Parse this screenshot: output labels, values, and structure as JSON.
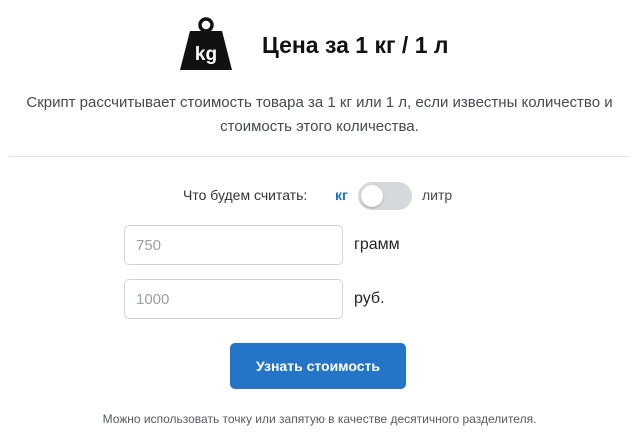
{
  "header": {
    "icon": "weight-kg-icon",
    "icon_text": "kg",
    "title": "Цена за 1 кг / 1 л"
  },
  "description": "Скрипт рассчитывает стоимость товара за 1 кг или 1 л, если известны количество и стоимость этого количества.",
  "toggle": {
    "question": "Что будем считать:",
    "left_label": "кг",
    "right_label": "литр",
    "selected": "кг"
  },
  "fields": {
    "amount": {
      "value": "",
      "placeholder": "750",
      "unit": "грамм"
    },
    "price": {
      "value": "",
      "placeholder": "1000",
      "unit": "руб."
    }
  },
  "submit": {
    "label": "Узнать стоимость"
  },
  "footnote": "Можно использовать точку или запятую в качестве десятичного разделителя.",
  "colors": {
    "accent": "#2474c8",
    "kg_label": "#1a6fc9",
    "switch_track": "#d6d9dc",
    "divider": "#dee2e6"
  }
}
